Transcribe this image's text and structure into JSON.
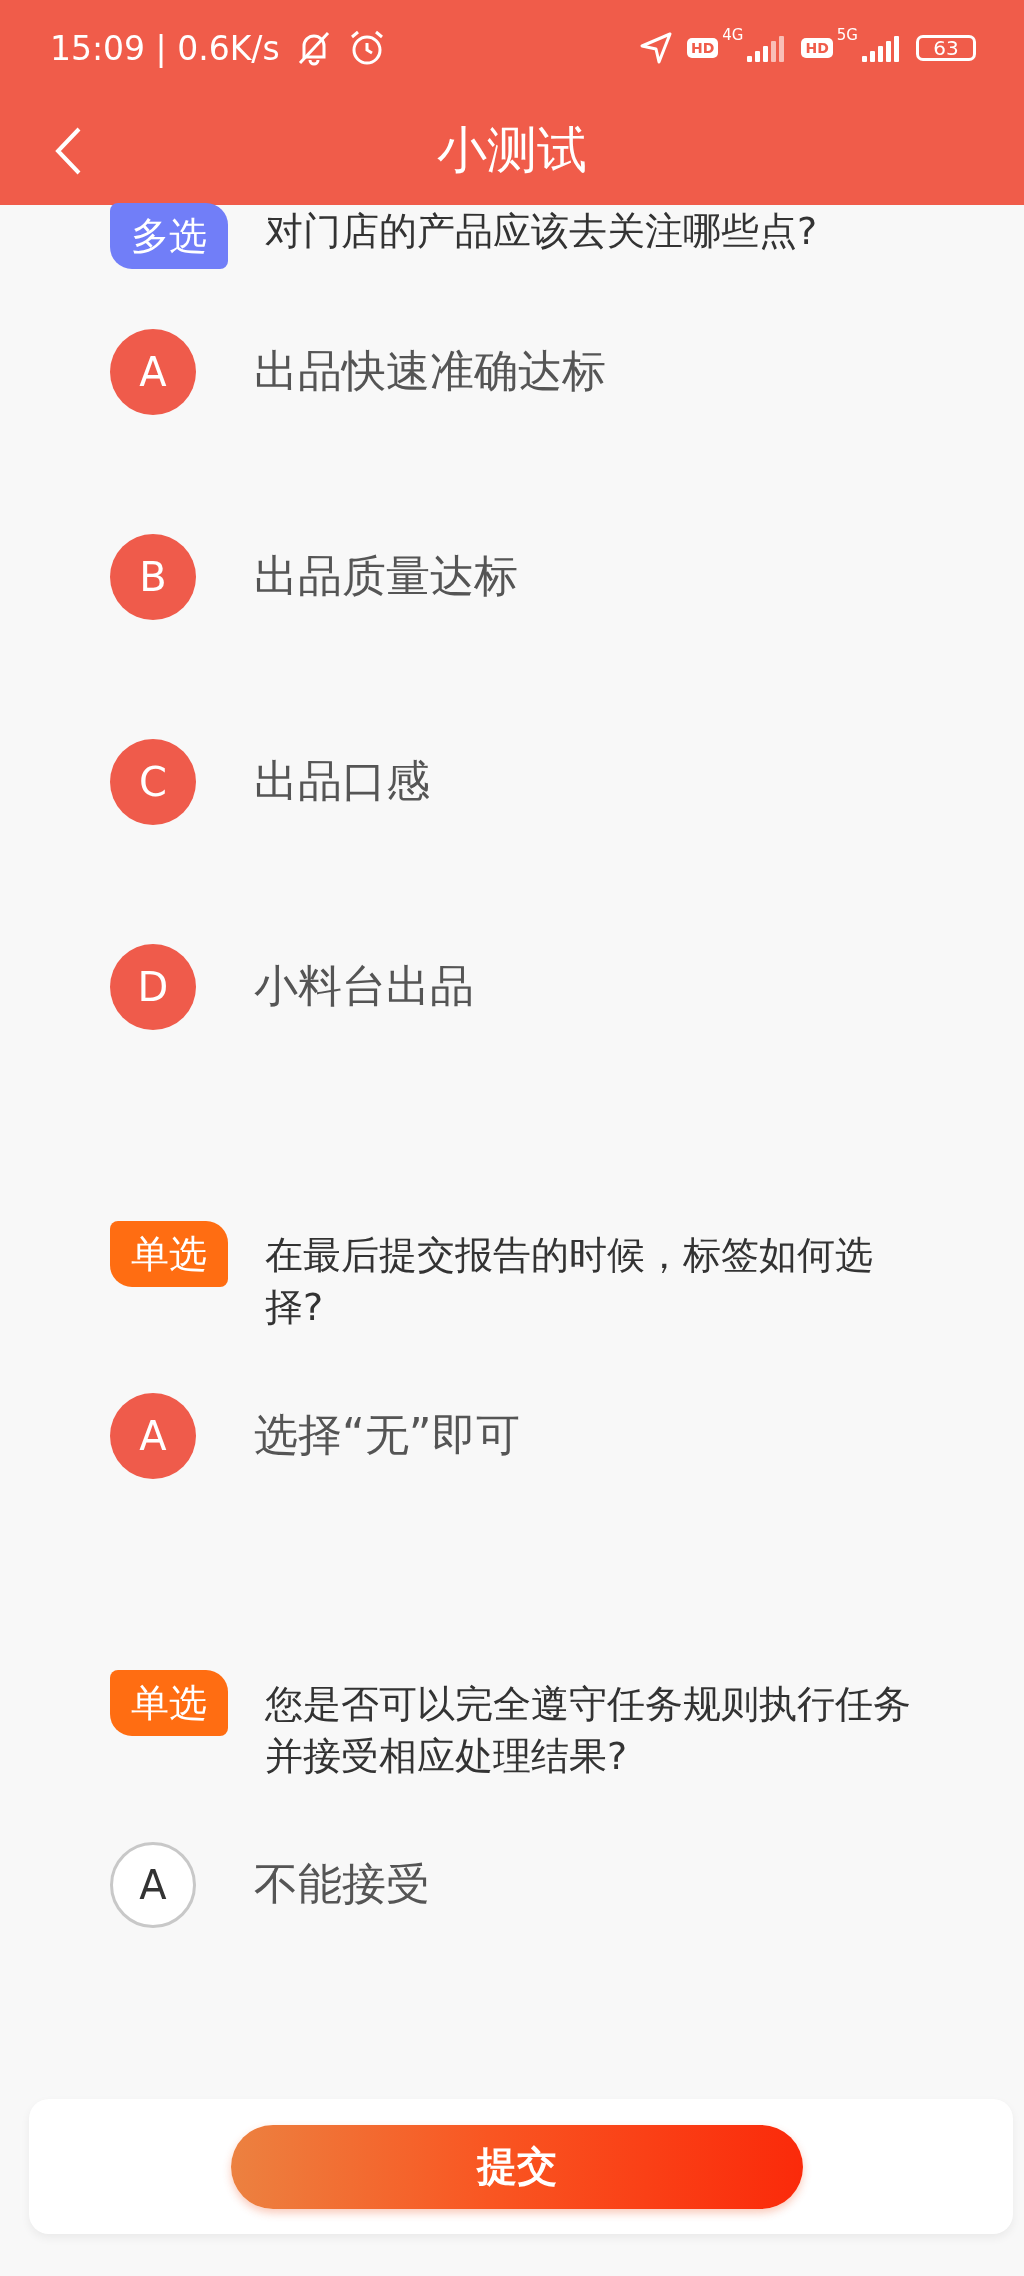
{
  "status_bar": {
    "time": "15:09 | 0.6K/s",
    "networks": [
      {
        "hd": "HD",
        "gen": "4G"
      },
      {
        "hd": "HD",
        "gen": "5G"
      }
    ],
    "battery": "63"
  },
  "header": {
    "title": "小测试"
  },
  "questions": [
    {
      "kind": "multi",
      "tag": "多选",
      "lines": [
        "对门店的产品应该去关注哪些点?"
      ],
      "options": [
        {
          "letter": "A",
          "text": "出品快速准确达标",
          "selected": true
        },
        {
          "letter": "B",
          "text": "出品质量达标",
          "selected": true
        },
        {
          "letter": "C",
          "text": "出品口感",
          "selected": true
        },
        {
          "letter": "D",
          "text": "小料台出品",
          "selected": true
        }
      ]
    },
    {
      "kind": "single",
      "tag": "单选",
      "lines": [
        "在最后提交报告的时候，标签如何选",
        "择?"
      ],
      "options": [
        {
          "letter": "A",
          "text": "选择“无”即可",
          "selected": true
        }
      ]
    },
    {
      "kind": "single",
      "tag": "单选",
      "lines": [
        "您是否可以完全遵守任务规则执行任务",
        "并接受相应处理结果?"
      ],
      "options": [
        {
          "letter": "A",
          "text": "不能接受",
          "selected": false
        }
      ]
    }
  ],
  "submit": {
    "label": "提交"
  }
}
